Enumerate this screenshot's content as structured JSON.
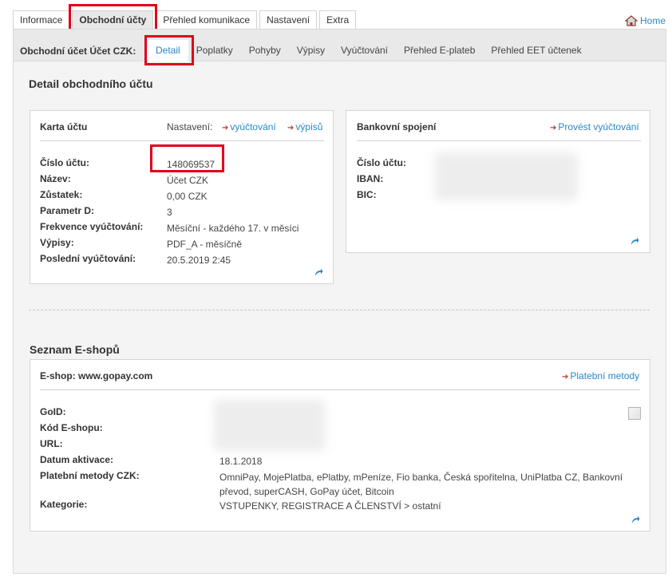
{
  "top_tabs": [
    {
      "label": "Informace"
    },
    {
      "label": "Obchodní účty"
    },
    {
      "label": "Přehled komunikace"
    },
    {
      "label": "Nastavení"
    },
    {
      "label": "Extra"
    }
  ],
  "home_label": "Home",
  "sub_title": "Obchodní účet Účet CZK:",
  "sub_tabs": [
    {
      "label": "Detail"
    },
    {
      "label": "Poplatky"
    },
    {
      "label": "Pohyby"
    },
    {
      "label": "Výpisy"
    },
    {
      "label": "Vyúčtování"
    },
    {
      "label": "Přehled E-plateb"
    },
    {
      "label": "Přehled EET účtenek"
    }
  ],
  "detail_heading": "Detail obchodního účtu",
  "account_card": {
    "title": "Karta účtu",
    "settings_label": "Nastavení:",
    "link_billing": "vyúčtování",
    "link_statements": "výpisů",
    "fields": [
      {
        "label": "Číslo účtu:",
        "value": "148069537"
      },
      {
        "label": "Název:",
        "value": "Účet CZK"
      },
      {
        "label": "Zůstatek:",
        "value": "0,00 CZK"
      },
      {
        "label": "Parametr D:",
        "value": "3"
      },
      {
        "label": "Frekvence vyúčtování:",
        "value": "Měsíční - každého 17. v měsíci"
      },
      {
        "label": "Výpisy:",
        "value": "PDF_A - měsíčně"
      },
      {
        "label": "Poslední vyúčtování:",
        "value": "20.5.2019 2:45"
      }
    ]
  },
  "bank_card": {
    "title": "Bankovní spojení",
    "link": "Provést vyúčtování",
    "fields": [
      {
        "label": "Číslo účtu:"
      },
      {
        "label": "IBAN:"
      },
      {
        "label": "BIC:"
      }
    ]
  },
  "eshops_heading": "Seznam E-shopů",
  "eshop_card": {
    "title": "E-shop: www.gopay.com",
    "link": "Platební metody",
    "fields": [
      {
        "label": "GoID:",
        "value": ""
      },
      {
        "label": "Kód E-shopu:",
        "value": ""
      },
      {
        "label": "URL:",
        "value": ""
      },
      {
        "label": "Datum aktivace:",
        "value": "18.1.2018"
      },
      {
        "label": "Platební metody CZK:",
        "value_line1": "OmniPay, MojePlatba, ePlatby, mPeníze, Fio banka, Česká spořitelna, UniPlatba CZ, Bankovní",
        "value_line2": "převod, superCASH, GoPay účet, Bitcoin"
      },
      {
        "label": "Kategorie:",
        "value": "VSTUPENKY, REGISTRACE A ČLENSTVÍ > ostatní"
      }
    ]
  },
  "colors": {
    "link": "#2a88c8",
    "highlight": "#e0001b"
  },
  "icons": [
    "home-icon",
    "refresh-icon",
    "arrow-right-icon",
    "broken-image-icon"
  ]
}
